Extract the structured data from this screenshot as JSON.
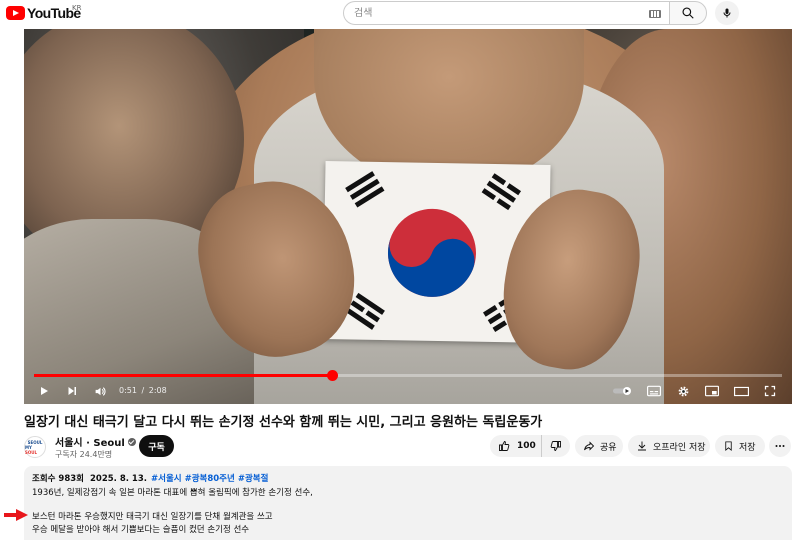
{
  "header": {
    "logo_text": "YouTube",
    "region": "KR",
    "search_placeholder": "검색",
    "icons": [
      "keyboard-icon",
      "search-icon",
      "mic-icon"
    ]
  },
  "player": {
    "current_time": "0:51",
    "duration": "2:08",
    "progress_fraction": 0.398,
    "icons": [
      "play-icon",
      "next-icon",
      "volume-icon",
      "autoplay-toggle",
      "subtitles-icon",
      "settings-icon",
      "miniplayer-icon",
      "theater-icon",
      "fullscreen-icon"
    ]
  },
  "video": {
    "title": "일장기 대신 태극기 달고 다시 뛰는 손기정 선수와 함께 뛰는 시민, 그리고 응원하는 독립운동가"
  },
  "channel": {
    "logo_top": "SEOUL",
    "logo_bottom_a": "MY ",
    "logo_bottom_b": "SOUL",
    "name": "서울시 · Seoul",
    "subscribers": "구독자 24.4만명",
    "subscribe_label": "구독"
  },
  "actions": {
    "like_count": "100",
    "share_label": "공유",
    "offline_label": "오프라인 저장",
    "save_label": "저장"
  },
  "description": {
    "views": "조회수 983회",
    "date": "2025. 8. 13.",
    "hashtags": [
      "#서울시",
      "#광복80주년",
      "#광복절"
    ],
    "line1": "1936년, 일제강점기 속 일본 마라톤 대표에 뽑혀 올림픽에 참가한 손기정 선수,",
    "line2": "보스턴 마라톤 우승했지만 태극기 대신 일장기를 단채  월계관을 쓰고",
    "line3": "우승 메달을 받아야 해서 기쁨보다는 슬픔이 컸던 손기정 선수"
  },
  "colors": {
    "brand_red": "#ff0000",
    "link_blue": "#065fd4",
    "subscribe_bg": "#0f0f0f",
    "pill_bg": "#f2f2f2"
  }
}
